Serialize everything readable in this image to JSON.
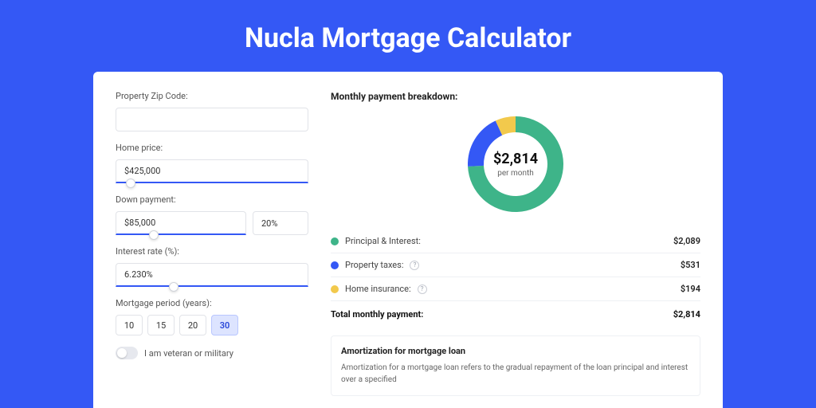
{
  "page": {
    "title": "Nucla Mortgage Calculator"
  },
  "form": {
    "zip": {
      "label": "Property Zip Code:",
      "value": ""
    },
    "home_price": {
      "label": "Home price:",
      "value": "$425,000",
      "slider_pct": 8
    },
    "down_payment": {
      "label": "Down payment:",
      "amount": "$85,000",
      "percent": "20%",
      "slider_pct": 20
    },
    "interest_rate": {
      "label": "Interest rate (%):",
      "value": "6.230%",
      "slider_pct": 30
    },
    "period": {
      "label": "Mortgage period (years):",
      "options": [
        "10",
        "15",
        "20",
        "30"
      ],
      "selected": "30"
    },
    "veteran": {
      "label": "I am veteran or military",
      "checked": false
    }
  },
  "breakdown": {
    "heading": "Monthly payment breakdown:",
    "center_value": "$2,814",
    "center_sub": "per month",
    "items": [
      {
        "label": "Principal & Interest:",
        "value": "$2,089",
        "pct": 74.24,
        "color": "#3eb489"
      },
      {
        "label": "Property taxes:",
        "value": "$531",
        "pct": 18.87,
        "color": "#3458f5",
        "info": true
      },
      {
        "label": "Home insurance:",
        "value": "$194",
        "pct": 6.89,
        "color": "#f2c94c",
        "info": true
      }
    ],
    "total_label": "Total monthly payment:",
    "total_value": "$2,814"
  },
  "amort": {
    "title": "Amortization for mortgage loan",
    "text": "Amortization for a mortgage loan refers to the gradual repayment of the loan principal and interest over a specified"
  },
  "chart_data": {
    "type": "pie",
    "title": "Monthly payment breakdown",
    "categories": [
      "Principal & Interest",
      "Property taxes",
      "Home insurance"
    ],
    "values": [
      2089,
      531,
      194
    ],
    "series_colors": [
      "#3eb489",
      "#3458f5",
      "#f2c94c"
    ],
    "total": 2814,
    "unit": "USD per month"
  }
}
